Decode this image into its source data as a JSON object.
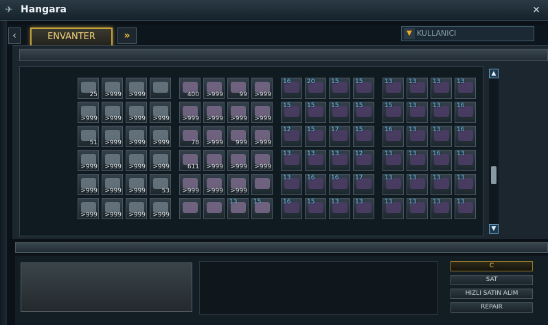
{
  "window": {
    "title": "Hangara",
    "close_icon": "close-icon"
  },
  "tabs": {
    "active": "ENVANTER"
  },
  "user_select": {
    "value": "KULLANICI"
  },
  "buttons": {
    "first": "C",
    "sat": "SAT",
    "hizli": "HIZLI SATIN ALIM",
    "repair": "REPAIR"
  },
  "left_items": [
    [
      "25",
      ">999",
      ">999",
      ""
    ],
    [
      ">999",
      ">999",
      ">999",
      ">999"
    ],
    [
      "51",
      ">999",
      ">999",
      ">999"
    ],
    [
      ">999",
      ">999",
      ">999",
      ">999"
    ],
    [
      ">999",
      ">999",
      ">999",
      "53"
    ],
    [
      ">999",
      ">999",
      ">999",
      ">999"
    ]
  ],
  "mid_items": [
    [
      "400",
      ">999",
      "99",
      ">999"
    ],
    [
      ">999",
      ">999",
      ">999",
      ">999"
    ],
    [
      "78",
      ">999",
      "999",
      ">999"
    ],
    [
      "611",
      ">999",
      ">999",
      ">999"
    ],
    [
      ">999",
      ">999",
      ">999",
      ""
    ],
    [
      "",
      "",
      "",
      ""
    ]
  ],
  "levels_a": [
    [
      "16",
      "20",
      "15",
      "15"
    ],
    [
      "15",
      "15",
      "15",
      "15"
    ],
    [
      "12",
      "15",
      "17",
      "15"
    ],
    [
      "13",
      "13",
      "13",
      "12"
    ],
    [
      "13",
      "16",
      "16",
      "17"
    ],
    [
      "16",
      "15",
      "13",
      "13"
    ]
  ],
  "levels_b": [
    [
      "13",
      "13",
      "13",
      "13"
    ],
    [
      "15",
      "13",
      "13",
      "16"
    ],
    [
      "16",
      "13",
      "13",
      "16"
    ],
    [
      "13",
      "13",
      "16",
      "13"
    ],
    [
      "13",
      "13",
      "13",
      "13"
    ],
    [
      "13",
      "13",
      "13",
      "13"
    ]
  ],
  "mid_levels_row6": [
    "",
    "",
    "13",
    "15"
  ]
}
